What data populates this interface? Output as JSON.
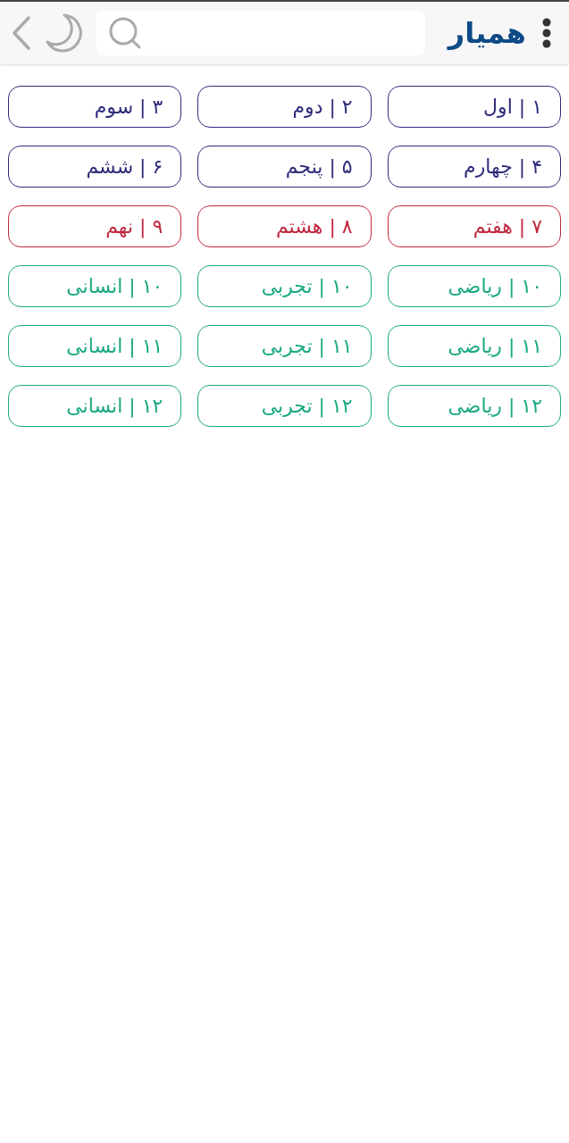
{
  "header": {
    "logo": "همیار"
  },
  "grades": [
    {
      "label": "۱ | اول",
      "color": "#2e2c7a"
    },
    {
      "label": "۲ | دوم",
      "color": "#2e2c7a"
    },
    {
      "label": "۳ | سوم",
      "color": "#2e2c7a"
    },
    {
      "label": "۴ | چهارم",
      "color": "#2e2c7a"
    },
    {
      "label": "۵ | پنجم",
      "color": "#2e2c7a"
    },
    {
      "label": "۶ | ششم",
      "color": "#2e2c7a"
    },
    {
      "label": "۷ | هفتم",
      "color": "#c0283f"
    },
    {
      "label": "۸ | هشتم",
      "color": "#c0283f"
    },
    {
      "label": "۹ | نهم",
      "color": "#c0283f"
    },
    {
      "label": "۱۰ | ریاضی",
      "color": "#1aa882"
    },
    {
      "label": "۱۰ | تجربی",
      "color": "#1aa882"
    },
    {
      "label": "۱۰ | انسانی",
      "color": "#1aa882"
    },
    {
      "label": "۱۱ | ریاضی",
      "color": "#1aa882"
    },
    {
      "label": "۱۱ | تجربی",
      "color": "#1aa882"
    },
    {
      "label": "۱۱ | انسانی",
      "color": "#1aa882"
    },
    {
      "label": "۱۲ | ریاضی",
      "color": "#1aa882"
    },
    {
      "label": "۱۲ | تجربی",
      "color": "#1aa882"
    },
    {
      "label": "۱۲ | انسانی",
      "color": "#1aa882"
    }
  ]
}
